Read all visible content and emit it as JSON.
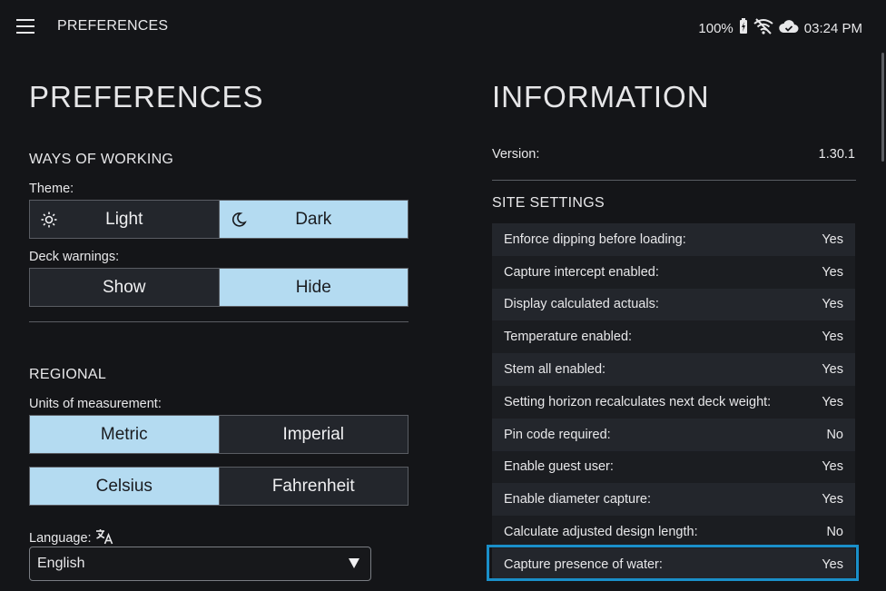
{
  "header": {
    "title": "PREFERENCES",
    "battery": "100%",
    "time": "03:24 PM",
    "icons": [
      "menu-icon",
      "battery-charging-icon",
      "wifi-off-icon",
      "cloud-check-icon"
    ]
  },
  "preferences": {
    "heading": "PREFERENCES",
    "ways_of_working": {
      "title": "WAYS OF WORKING",
      "theme_label": "Theme:",
      "theme_options": [
        "Light",
        "Dark"
      ],
      "theme_selected": "Dark",
      "deck_warnings_label": "Deck warnings:",
      "deck_options": [
        "Show",
        "Hide"
      ],
      "deck_selected": "Hide"
    },
    "regional": {
      "title": "REGIONAL",
      "units_label": "Units of measurement:",
      "units_options": [
        "Metric",
        "Imperial"
      ],
      "units_selected": "Metric",
      "temp_options": [
        "Celsius",
        "Fahrenheit"
      ],
      "temp_selected": "Celsius",
      "language_label": "Language:",
      "language_value": "English"
    }
  },
  "information": {
    "heading": "INFORMATION",
    "version_label": "Version:",
    "version_value": "1.30.1",
    "site_settings_title": "SITE SETTINGS",
    "settings": [
      {
        "label": "Enforce dipping before loading:",
        "value": "Yes"
      },
      {
        "label": "Capture intercept enabled:",
        "value": "Yes"
      },
      {
        "label": "Display calculated actuals:",
        "value": "Yes"
      },
      {
        "label": "Temperature enabled:",
        "value": "Yes"
      },
      {
        "label": "Stem all enabled:",
        "value": "Yes"
      },
      {
        "label": "Setting horizon recalculates next deck weight:",
        "value": "Yes"
      },
      {
        "label": "Pin code required:",
        "value": "No"
      },
      {
        "label": "Enable guest user:",
        "value": "Yes"
      },
      {
        "label": "Enable diameter capture:",
        "value": "Yes"
      },
      {
        "label": "Calculate adjusted design length:",
        "value": "No"
      },
      {
        "label": "Capture presence of water:",
        "value": "Yes"
      }
    ]
  },
  "colors": {
    "background": "#141518",
    "selected": "#b4dbf1",
    "unselected": "#23262c",
    "highlight": "#1a8fc9"
  }
}
